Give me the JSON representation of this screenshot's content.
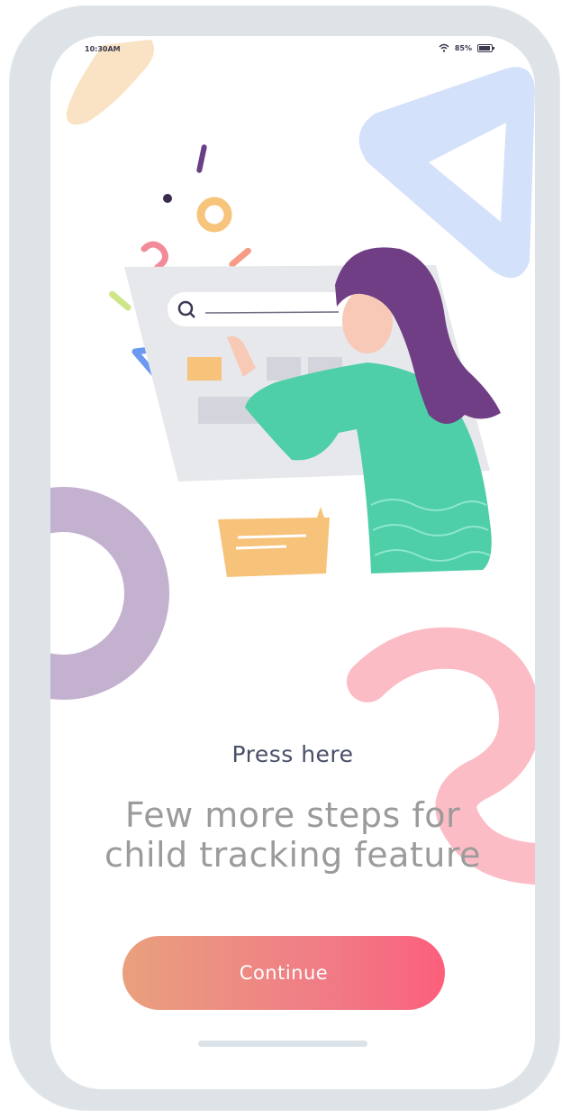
{
  "status_bar": {
    "time": "10:30AM",
    "battery_percent": "85%",
    "icons": [
      "wifi-icon",
      "battery-icon"
    ]
  },
  "illustration": {
    "description_icons": [
      "search-icon",
      "chat-bubble-icon"
    ]
  },
  "prompt": {
    "label": "Press here"
  },
  "headline": {
    "line1": "Few more steps for",
    "line2": "child tracking feature"
  },
  "actions": {
    "continue_label": "Continue"
  },
  "colors": {
    "accent_start": "#e9a07d",
    "accent_end": "#fc5f7b",
    "frame": "#dde3e7",
    "text_dark": "#4a4f68",
    "text_muted": "#9b9b9b"
  }
}
